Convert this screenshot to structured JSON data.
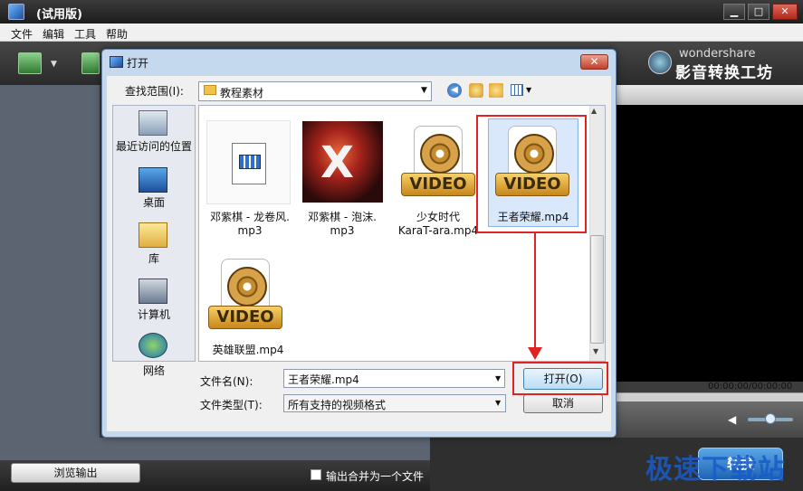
{
  "app": {
    "title": "(试用版)",
    "menu": [
      "文件",
      "编辑",
      "工具",
      "帮助"
    ],
    "brand_en": "wondershare",
    "brand_cn": "影音转换工坊",
    "timecode": "00:00:00/00:00:00",
    "browse_output": "浏览输出",
    "merge_label": "输出合并为一个文件",
    "convert_label": "转换",
    "watermark": "极速下载站"
  },
  "dialog": {
    "title": "打开",
    "close_glyph": "✕",
    "lookin_label": "查找范围(I):",
    "lookin_value": "教程素材",
    "places": [
      {
        "label": "最近访问的位置",
        "icon": "recent-places-icon"
      },
      {
        "label": "桌面",
        "icon": "desktop-icon"
      },
      {
        "label": "库",
        "icon": "library-icon"
      },
      {
        "label": "计算机",
        "icon": "computer-icon"
      },
      {
        "label": "网络",
        "icon": "network-icon"
      }
    ],
    "files": [
      {
        "label_1": "邓紫棋 - 龙卷风.",
        "label_2": "mp3",
        "type": "audio"
      },
      {
        "label_1": "邓紫棋 - 泡沫.",
        "label_2": "mp3",
        "type": "audio-album"
      },
      {
        "label_1": "少女时代",
        "label_2": "KaraT-ara.mp4",
        "type": "video"
      },
      {
        "label_1": "王者荣耀.mp4",
        "type": "video",
        "selected": true
      },
      {
        "label_1": "英雄联盟.mp4",
        "type": "video"
      }
    ],
    "video_badge": "VIDEO",
    "album_mark": "X",
    "filename_label": "文件名(N):",
    "filename_value": "王者荣耀.mp4",
    "filetype_label": "文件类型(T):",
    "filetype_value": "所有支持的视频格式",
    "open_button": "打开(O)",
    "cancel_button": "取消",
    "highlight_color": "#e02424"
  }
}
